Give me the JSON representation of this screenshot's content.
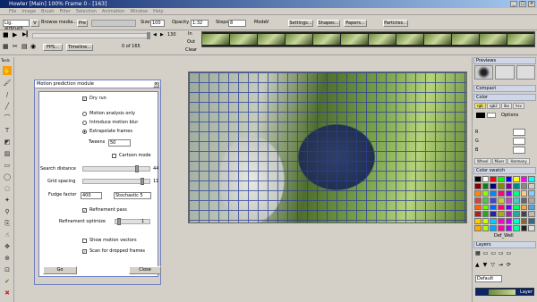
{
  "window": {
    "title": "Howler [Main]  100% Frame 0 - [163]"
  },
  "menu": [
    "File",
    "Image",
    "Brush",
    "Filter",
    "Selection",
    "Animation",
    "Window",
    "Help"
  ],
  "toolbar": {
    "brush_value": "Lig. airbrush",
    "browse_label": "Browse media...",
    "size_label": "Size",
    "size_value": "100",
    "opacity_label": "Opacity",
    "opacity_value": "1:32",
    "steps_label": "Steps",
    "steps_value": "8",
    "mode_label": "Mode",
    "mode_value": "V",
    "settings_label": "Settings...",
    "shapes_label": "Shapes...",
    "papers_label": "Papers...",
    "particles_label": "Particles..."
  },
  "timeline": {
    "frame_count": "130",
    "fps_label": "FPS...",
    "timeline_label": "Timeline...",
    "frame_of": "0 of 165",
    "in_label": "In",
    "out_label": "Out",
    "clear_label": "Clear"
  },
  "tools_label": "Tools",
  "dialog": {
    "title": "Motion prediction module",
    "dry_run": "Dry run",
    "motion_only": "Motion analysis only",
    "motion_blur": "Introduce motion blur",
    "extrapolate": "Extrapolate frames",
    "tweens_label": "Tweens",
    "tweens_value": "50",
    "cartoon_mode": "Cartoon mode",
    "search_distance_label": "Search distance",
    "search_distance_value": "44",
    "search_distance_level": 0.82,
    "grid_spacing_label": "Grid spacing",
    "grid_spacing_value": "11",
    "grid_spacing_level": 0.9,
    "fudge_label": "Fudge factor",
    "fudge_value": "400",
    "stochastic_value": "Stochastic 5",
    "refinement_pass": "Refinement pass",
    "refinement_optimize_label": "Refinement optimize",
    "refinement_optimize_value": "1",
    "refinement_optimize_level": 0.05,
    "show_motion_vectors": "Show motion vectors",
    "scan_dropped": "Scan for dropped frames",
    "go_label": "Go",
    "close_label": "Close"
  },
  "right_panel": {
    "previews": "Previews",
    "compact": "Compact",
    "color": "Color",
    "color_tabs": [
      "rgb",
      "rgb2",
      "lbo",
      "hsv"
    ],
    "options": "Options",
    "r": "R",
    "g": "G",
    "b": "B",
    "wheel_tabs": [
      "Wheel",
      "Mixer",
      "Harmony"
    ],
    "swatch": "Color swatch",
    "swatch_name": "Def_Well",
    "layers": "Layers",
    "layer_mode": "Default",
    "layer_name": "Layer"
  },
  "colors": {
    "title_start": "#0a246a",
    "title_end": "#a6caf0",
    "section_bg": "#cfd6e6",
    "grid_line": "#2a3d9a"
  }
}
